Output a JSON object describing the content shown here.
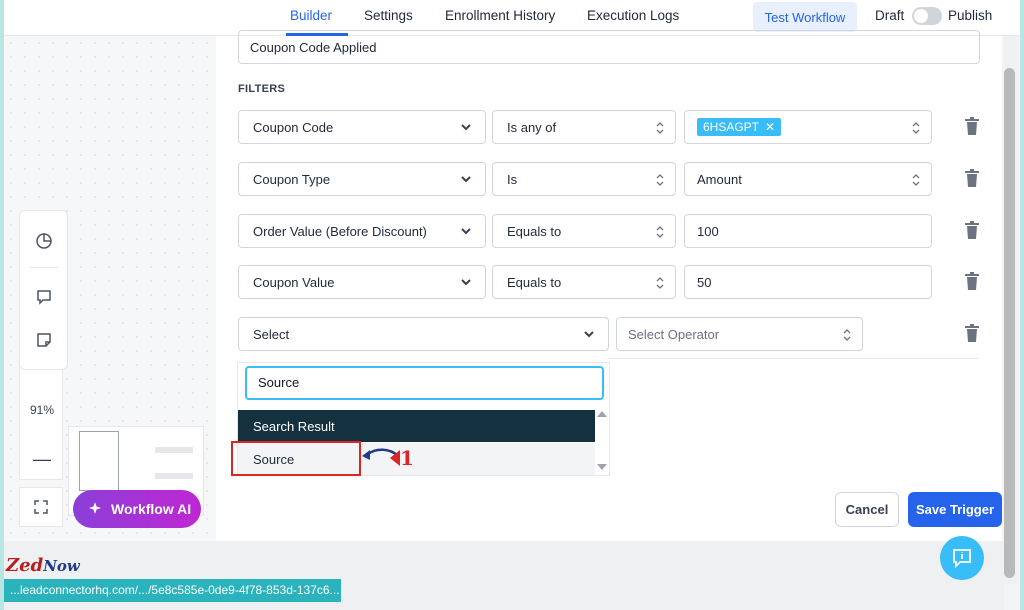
{
  "header": {
    "tabs": [
      {
        "label": "Builder",
        "active": true
      },
      {
        "label": "Settings",
        "active": false
      },
      {
        "label": "Enrollment History",
        "active": false
      },
      {
        "label": "Execution Logs",
        "active": false
      }
    ],
    "test_button": "Test Workflow",
    "draft_label": "Draft",
    "publish_label": "Publish",
    "publish_toggle_on": false
  },
  "canvas": {
    "zoom": "91%",
    "zoom_out_label": "—",
    "workflow_ai_label": "Workflow AI"
  },
  "trigger": {
    "name_value": "Coupon Code Applied",
    "filters_title": "FILTERS",
    "filters": [
      {
        "field": "Coupon Code",
        "operator": "Is any of",
        "value_tag": "6HSAGPT"
      },
      {
        "field": "Coupon Type",
        "operator": "Is",
        "value": "Amount"
      },
      {
        "field": "Order Value (Before Discount)",
        "operator": "Equals to",
        "value": "100"
      },
      {
        "field": "Coupon Value",
        "operator": "Equals to",
        "value": "50"
      }
    ],
    "new_filter": {
      "field_placeholder": "Select",
      "operator_placeholder": "Select Operator"
    },
    "dropdown": {
      "search_value": "Source",
      "header": "Search Result",
      "items": [
        "Source"
      ]
    },
    "annotation_number": "1",
    "cancel_label": "Cancel",
    "save_label": "Save Trigger"
  },
  "logo": {
    "part1": "ZedNow",
    "part1_a": "Zed",
    "part1_b": "Now"
  },
  "status_url": "...leadconnectorhq.com/.../5e8c585e-0de9-4f78-853d-137c6...",
  "colors": {
    "accent": "#2563eb",
    "tag": "#38bdf8",
    "ai_gradient_start": "#8b3fd8",
    "ai_gradient_end": "#c026d3",
    "dropdown_header": "#14313f",
    "highlight": "#dc2626"
  }
}
